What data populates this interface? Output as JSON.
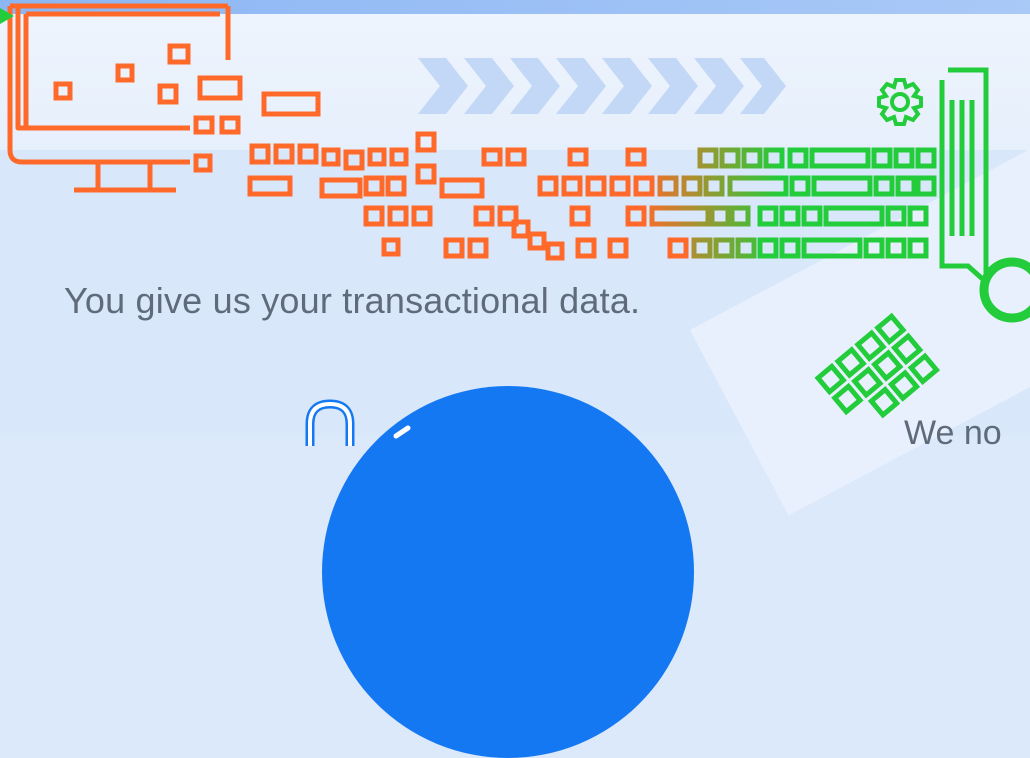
{
  "headline": "You give us your transactional data.",
  "next_caption_fragment": "We no",
  "icons": {
    "monitor": "monitor-icon",
    "gear": "gear-icon",
    "search": "magnifier-icon",
    "chevrons": "chevron-right-icon",
    "clip": "paperclip-icon"
  },
  "colors": {
    "orange": "#ff6a2b",
    "green": "#22cc3a",
    "blue": "#1478f2",
    "chevron": "#c3d8f7",
    "text": "#5f6b7a"
  }
}
